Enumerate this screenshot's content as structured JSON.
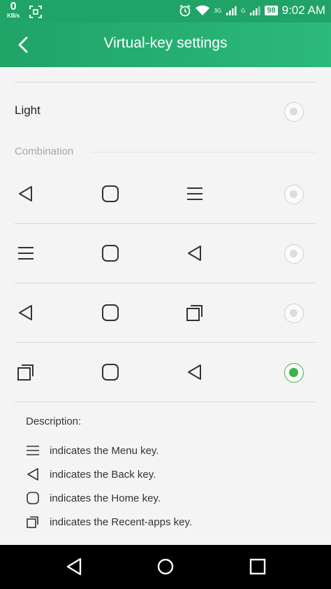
{
  "status_bar": {
    "speed_value": "0",
    "speed_unit": "KB/s",
    "net_a": "3G",
    "net_b": "G",
    "battery": "98",
    "time": "9:02 AM"
  },
  "app_bar": {
    "title": "Virtual-key settings"
  },
  "light_option": {
    "label": "Light",
    "selected": false
  },
  "combination": {
    "label": "Combination",
    "rows": [
      {
        "keys": [
          "back",
          "home",
          "menu"
        ],
        "selected": false
      },
      {
        "keys": [
          "menu",
          "home",
          "back"
        ],
        "selected": false
      },
      {
        "keys": [
          "back",
          "home",
          "recent"
        ],
        "selected": false
      },
      {
        "keys": [
          "recent",
          "home",
          "back"
        ],
        "selected": true
      }
    ]
  },
  "description": {
    "title": "Description:",
    "items": [
      {
        "icon": "menu-icon",
        "text": "indicates the Menu key."
      },
      {
        "icon": "back-icon",
        "text": "indicates the Back key."
      },
      {
        "icon": "home-icon",
        "text": "indicates the Home key."
      },
      {
        "icon": "recent-apps-icon",
        "text": "indicates the Recent-apps key."
      }
    ]
  },
  "colors": {
    "accent": "#1fa366",
    "radio_selected": "#3cb44a"
  }
}
